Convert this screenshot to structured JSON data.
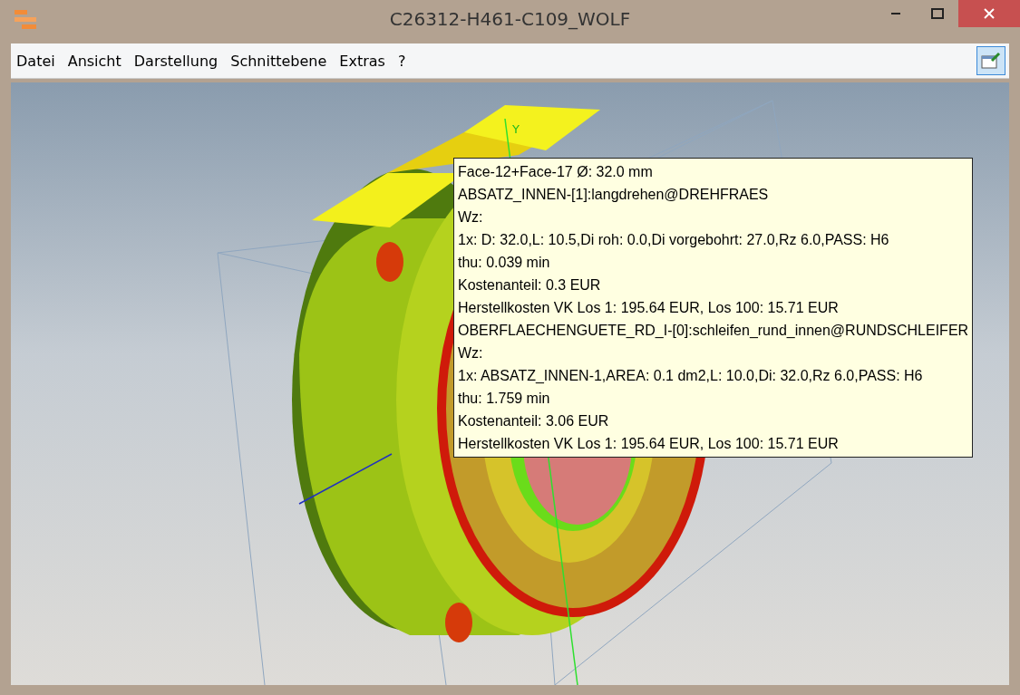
{
  "window": {
    "title": "C26312-H461-C109_WOLF"
  },
  "menu": [
    {
      "label": "Datei"
    },
    {
      "label": "Ansicht"
    },
    {
      "label": "Darstellung"
    },
    {
      "label": "Schnittebene"
    },
    {
      "label": "Extras"
    },
    {
      "label": "?"
    }
  ],
  "toolbar": {
    "pin_pressed": true
  },
  "viewport": {
    "axis_label": "Y",
    "tooltip": [
      "Face-12+Face-17 Ø: 32.0 mm",
      "ABSATZ_INNEN-[1]:langdrehen@DREHFRAES",
      "Wz:",
      "1x: D: 32.0,L: 10.5,Di roh: 0.0,Di vorgebohrt: 27.0,Rz 6.0,PASS: H6",
      "thu: 0.039 min",
      "Kostenanteil: 0.3 EUR",
      "Herstellkosten VK Los 1: 195.64 EUR, Los 100: 15.71 EUR",
      "OBERFLAECHENGUETE_RD_I-[0]:schleifen_rund_innen@RUNDSCHLEIFER",
      "Wz:",
      "1x: ABSATZ_INNEN-1,AREA: 0.1 dm2,L: 10.0,Di: 32.0,Rz 6.0,PASS: H6",
      "thu: 1.759 min",
      "Kostenanteil: 3.06 EUR",
      "Herstellkosten VK Los 1: 195.64 EUR, Los 100: 15.71 EUR"
    ]
  }
}
